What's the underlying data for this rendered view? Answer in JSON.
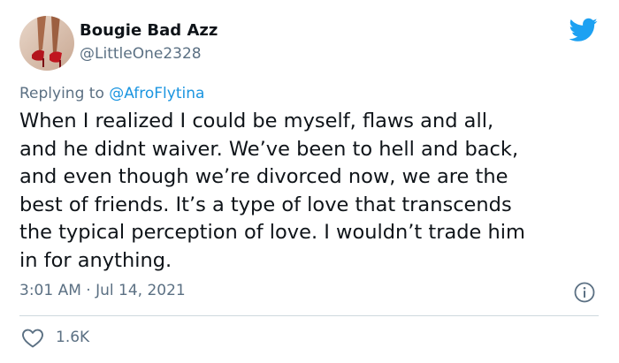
{
  "author": {
    "display_name": "Bougie Bad Azz",
    "handle": "@LittleOne2328"
  },
  "reply": {
    "prefix": "Replying to",
    "mention": "@AfroFlytina"
  },
  "tweet": {
    "lines": [
      "When I realized I could be myself, flaws and all,",
      "and he didnt waiver. We’ve been to hell and back,",
      "and even though we’re divorced now, we are the",
      "best of friends. It’s a type of love that transcends",
      "the typical perception of love. I wouldn’t trade him",
      "in for anything."
    ]
  },
  "timestamp": "3:01 AM · Jul 14, 2021",
  "stats": {
    "likes": "1.6K"
  },
  "icons": {
    "brand": "twitter-bird-icon",
    "info": "info-icon",
    "like": "heart-icon"
  },
  "colors": {
    "brand": "#1da1f2",
    "mention": "#1b95e0",
    "secondary_text": "#5b7083",
    "divider": "#cfd9de"
  }
}
